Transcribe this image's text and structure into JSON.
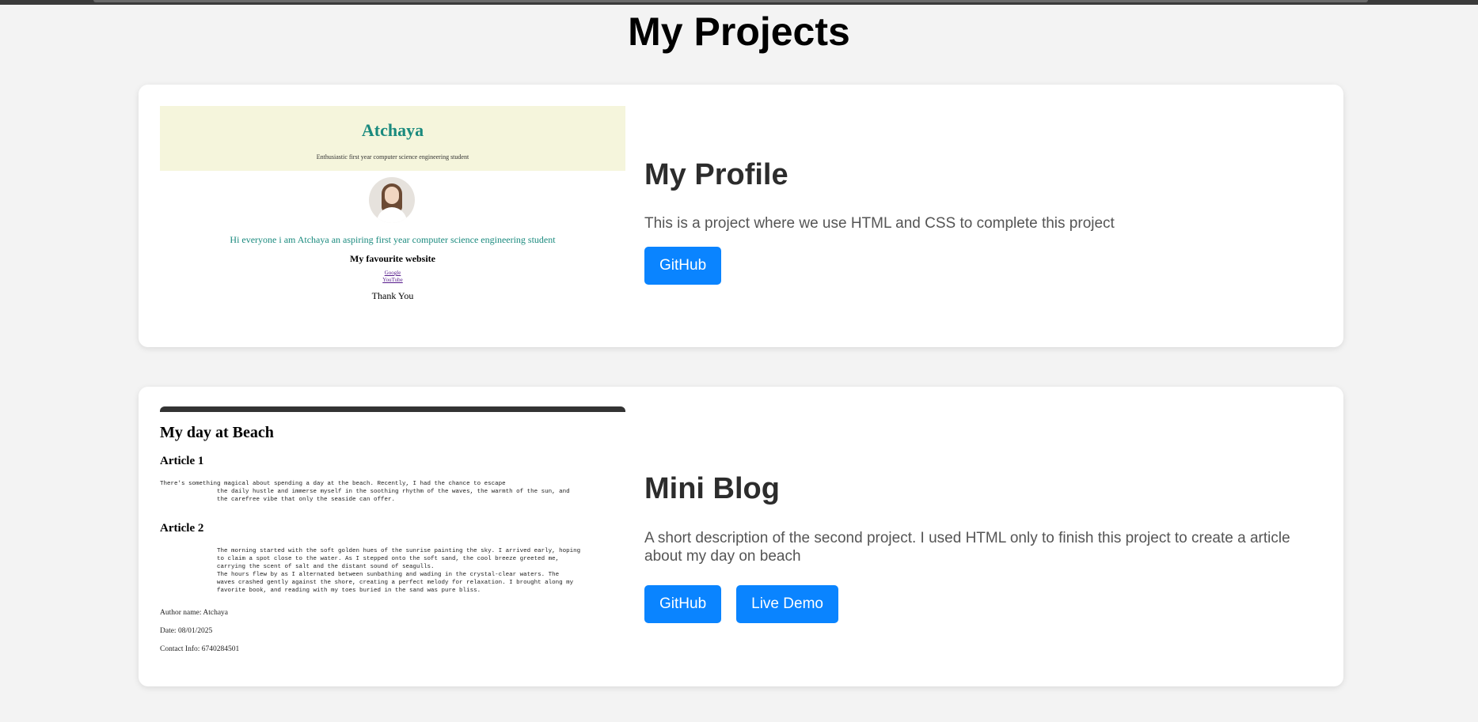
{
  "page": {
    "title": "My Projects"
  },
  "projects": [
    {
      "title": "My Profile",
      "description": "This is a project where we use HTML and CSS to complete this project",
      "buttons": [
        "GitHub"
      ],
      "preview": {
        "name": "Atchaya",
        "tagline": "Enthusiastic first year computer science engineering student",
        "intro": "Hi everyone i am Atchaya an aspiring first year computer science engineering student",
        "favourite_heading": "My favourite website",
        "links": [
          "Google",
          "YouTube"
        ],
        "closing": "Thank You"
      }
    },
    {
      "title": "Mini Blog",
      "description": "A short description of the second project. I used HTML only to finish this project to create a article about my day on beach",
      "buttons": [
        "GitHub",
        "Live Demo"
      ],
      "preview": {
        "title": "My day at Beach",
        "article1_heading": "Article 1",
        "article1_text": "There's something magical about spending a day at the beach. Recently, I had the chance to escape\n                the daily hustle and immerse myself in the soothing rhythm of the waves, the warmth of the sun, and\n                the carefree vibe that only the seaside can offer.",
        "article2_heading": "Article 2",
        "article2_text": "                The morning started with the soft golden hues of the sunrise painting the sky. I arrived early, hoping\n                to claim a spot close to the water. As I stepped onto the soft sand, the cool breeze greeted me,\n                carrying the scent of salt and the distant sound of seagulls.\n                The hours flew by as I alternated between sunbathing and wading in the crystal-clear waters. The\n                waves crashed gently against the shore, creating a perfect melody for relaxation. I brought along my\n                favorite book, and reading with my toes buried in the sand was pure bliss.",
        "author": "Author name: Atchaya",
        "date": "Date: 08/01/2025",
        "contact": "Contact Info: 6740284501"
      }
    }
  ],
  "colors": {
    "accent": "#0a84ff",
    "background": "#f3f3f3",
    "profile_teal": "#1a8a7e",
    "profile_header_bg": "#f5f5dc"
  }
}
